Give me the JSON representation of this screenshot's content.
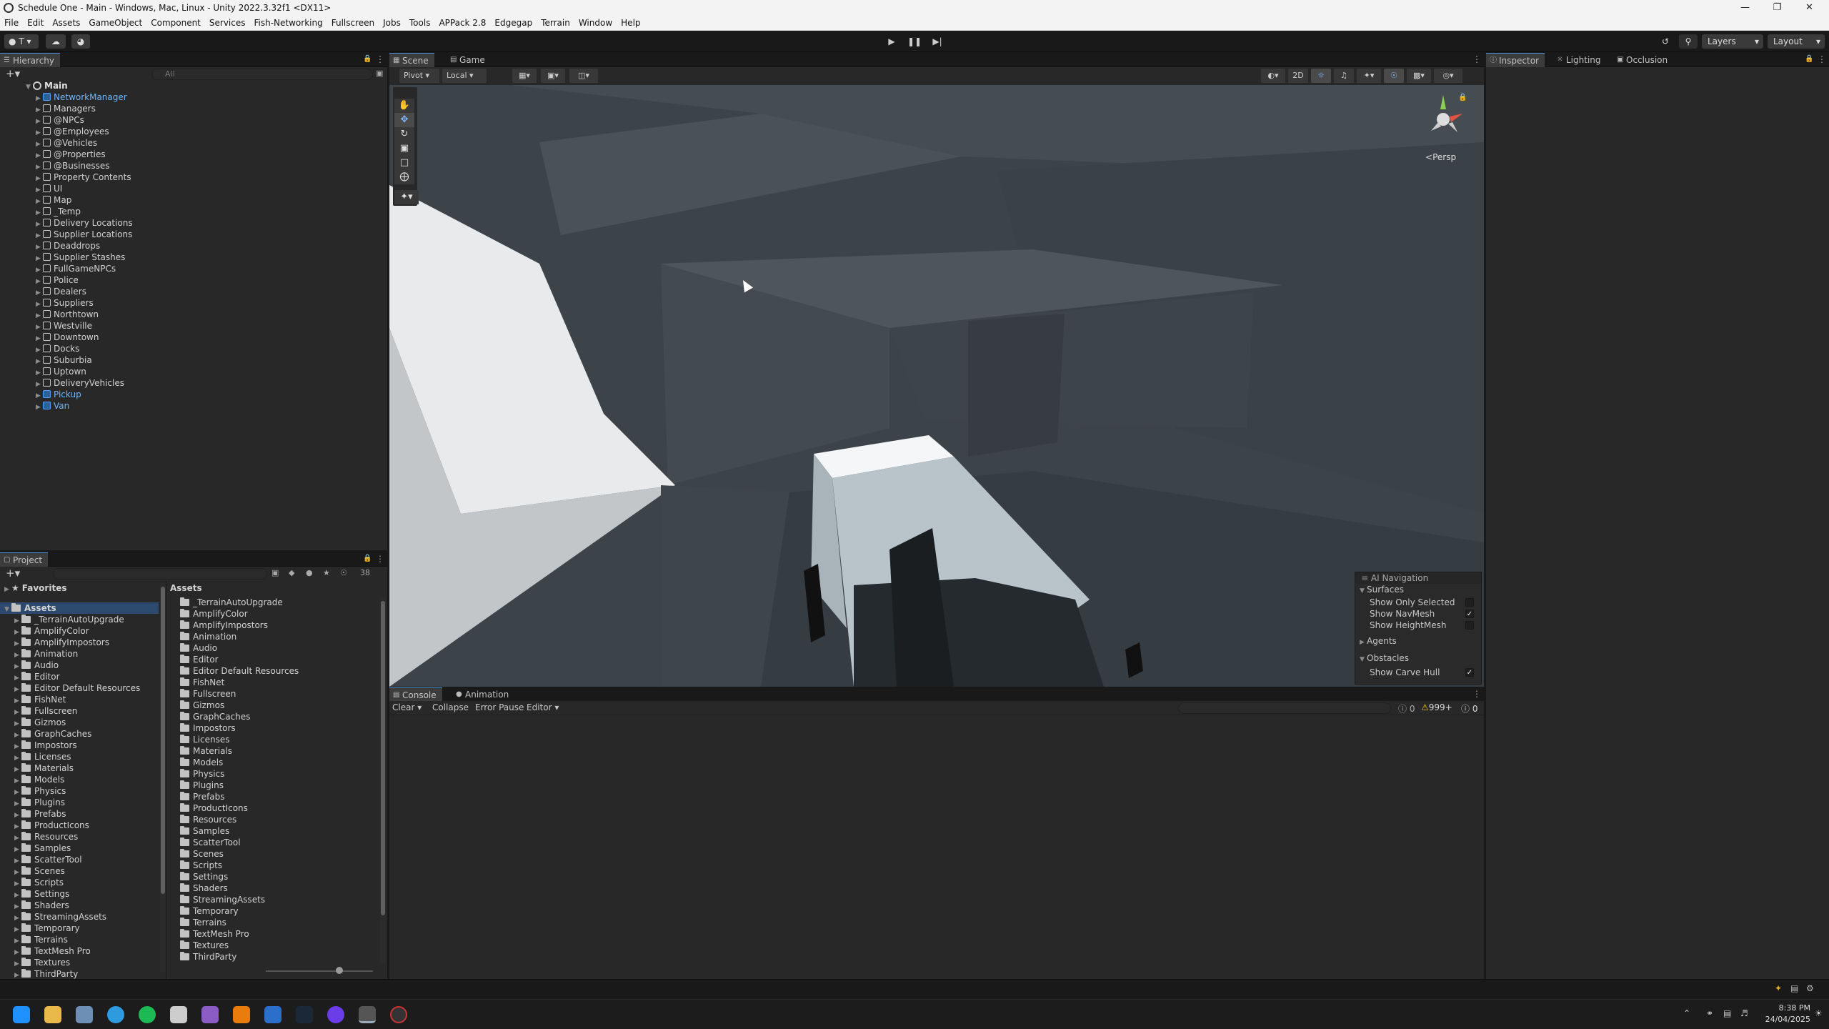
{
  "window": {
    "title": "Schedule One - Main - Windows, Mac, Linux - Unity 2022.3.32f1 <DX11>"
  },
  "menu": [
    "File",
    "Edit",
    "Assets",
    "GameObject",
    "Component",
    "Services",
    "Fish-Networking",
    "Fullscreen",
    "Jobs",
    "Tools",
    "APPack 2.8",
    "Edgegap",
    "Terrain",
    "Window",
    "Help"
  ],
  "toolbar": {
    "account": "T",
    "layers": "Layers",
    "layout": "Layout"
  },
  "hierarchy": {
    "tab": "Hierarchy",
    "search_placeholder": "All",
    "scene_name": "Main",
    "items": [
      {
        "label": "NetworkManager",
        "prefab": true
      },
      {
        "label": "Managers",
        "prefab": false
      },
      {
        "label": "@NPCs",
        "prefab": false
      },
      {
        "label": "@Employees",
        "prefab": false
      },
      {
        "label": "@Vehicles",
        "prefab": false
      },
      {
        "label": "@Properties",
        "prefab": false
      },
      {
        "label": "@Businesses",
        "prefab": false
      },
      {
        "label": "Property Contents",
        "prefab": false
      },
      {
        "label": "UI",
        "prefab": false
      },
      {
        "label": "Map",
        "prefab": false
      },
      {
        "label": "_Temp",
        "prefab": false
      },
      {
        "label": "Delivery Locations",
        "prefab": false
      },
      {
        "label": "Supplier Locations",
        "prefab": false
      },
      {
        "label": "Deaddrops",
        "prefab": false
      },
      {
        "label": "Supplier Stashes",
        "prefab": false
      },
      {
        "label": "FullGameNPCs",
        "prefab": false
      },
      {
        "label": "Police",
        "prefab": false
      },
      {
        "label": "Dealers",
        "prefab": false
      },
      {
        "label": "Suppliers",
        "prefab": false
      },
      {
        "label": "Northtown",
        "prefab": false
      },
      {
        "label": "Westville",
        "prefab": false
      },
      {
        "label": "Downtown",
        "prefab": false
      },
      {
        "label": "Docks",
        "prefab": false
      },
      {
        "label": "Suburbia",
        "prefab": false
      },
      {
        "label": "Uptown",
        "prefab": false
      },
      {
        "label": "DeliveryVehicles",
        "prefab": false
      },
      {
        "label": "Pickup",
        "prefab": true
      },
      {
        "label": "Van",
        "prefab": true
      }
    ]
  },
  "project": {
    "tab": "Project",
    "count": "38",
    "favorites": "Favorites",
    "assets_root": "Assets",
    "assets_header": "Assets",
    "left_tree": [
      "_TerrainAutoUpgrade",
      "AmplifyColor",
      "AmplifyImpostors",
      "Animation",
      "Audio",
      "Editor",
      "Editor Default Resources",
      "FishNet",
      "Fullscreen",
      "Gizmos",
      "GraphCaches",
      "Impostors",
      "Licenses",
      "Materials",
      "Models",
      "Physics",
      "Plugins",
      "Prefabs",
      "ProductIcons",
      "Resources",
      "Samples",
      "ScatterTool",
      "Scenes",
      "Scripts",
      "Settings",
      "Shaders",
      "StreamingAssets",
      "Temporary",
      "Terrains",
      "TextMesh Pro",
      "Textures",
      "ThirdParty"
    ],
    "right_list": [
      "_TerrainAutoUpgrade",
      "AmplifyColor",
      "AmplifyImpostors",
      "Animation",
      "Audio",
      "Editor",
      "Editor Default Resources",
      "FishNet",
      "Fullscreen",
      "Gizmos",
      "GraphCaches",
      "Impostors",
      "Licenses",
      "Materials",
      "Models",
      "Physics",
      "Plugins",
      "Prefabs",
      "ProductIcons",
      "Resources",
      "Samples",
      "ScatterTool",
      "Scenes",
      "Scripts",
      "Settings",
      "Shaders",
      "StreamingAssets",
      "Temporary",
      "Terrains",
      "TextMesh Pro",
      "Textures",
      "ThirdParty"
    ]
  },
  "scene": {
    "tabs": [
      "Scene",
      "Game"
    ],
    "pivot": "Pivot",
    "local": "Local",
    "mode_2d": "2D",
    "persp": "Persp",
    "ai_nav": {
      "title": "AI Navigation",
      "surfaces": "Surfaces",
      "show_only_selected": "Show Only Selected",
      "show_navmesh": "Show NavMesh",
      "show_heightmesh": "Show HeightMesh",
      "agents": "Agents",
      "obstacles": "Obstacles",
      "show_carve_hull": "Show Carve Hull"
    }
  },
  "inspector": {
    "tabs": [
      "Inspector",
      "Lighting",
      "Occlusion"
    ]
  },
  "console": {
    "tabs": [
      "Console",
      "Animation"
    ],
    "clear": "Clear",
    "collapse": "Collapse",
    "error_pause": "Error Pause",
    "editor": "Editor",
    "log_count": "0",
    "warn_count": "999+",
    "error_count": "0"
  },
  "taskbar": {
    "time": "8:38 PM",
    "date": "24/04/2025"
  }
}
